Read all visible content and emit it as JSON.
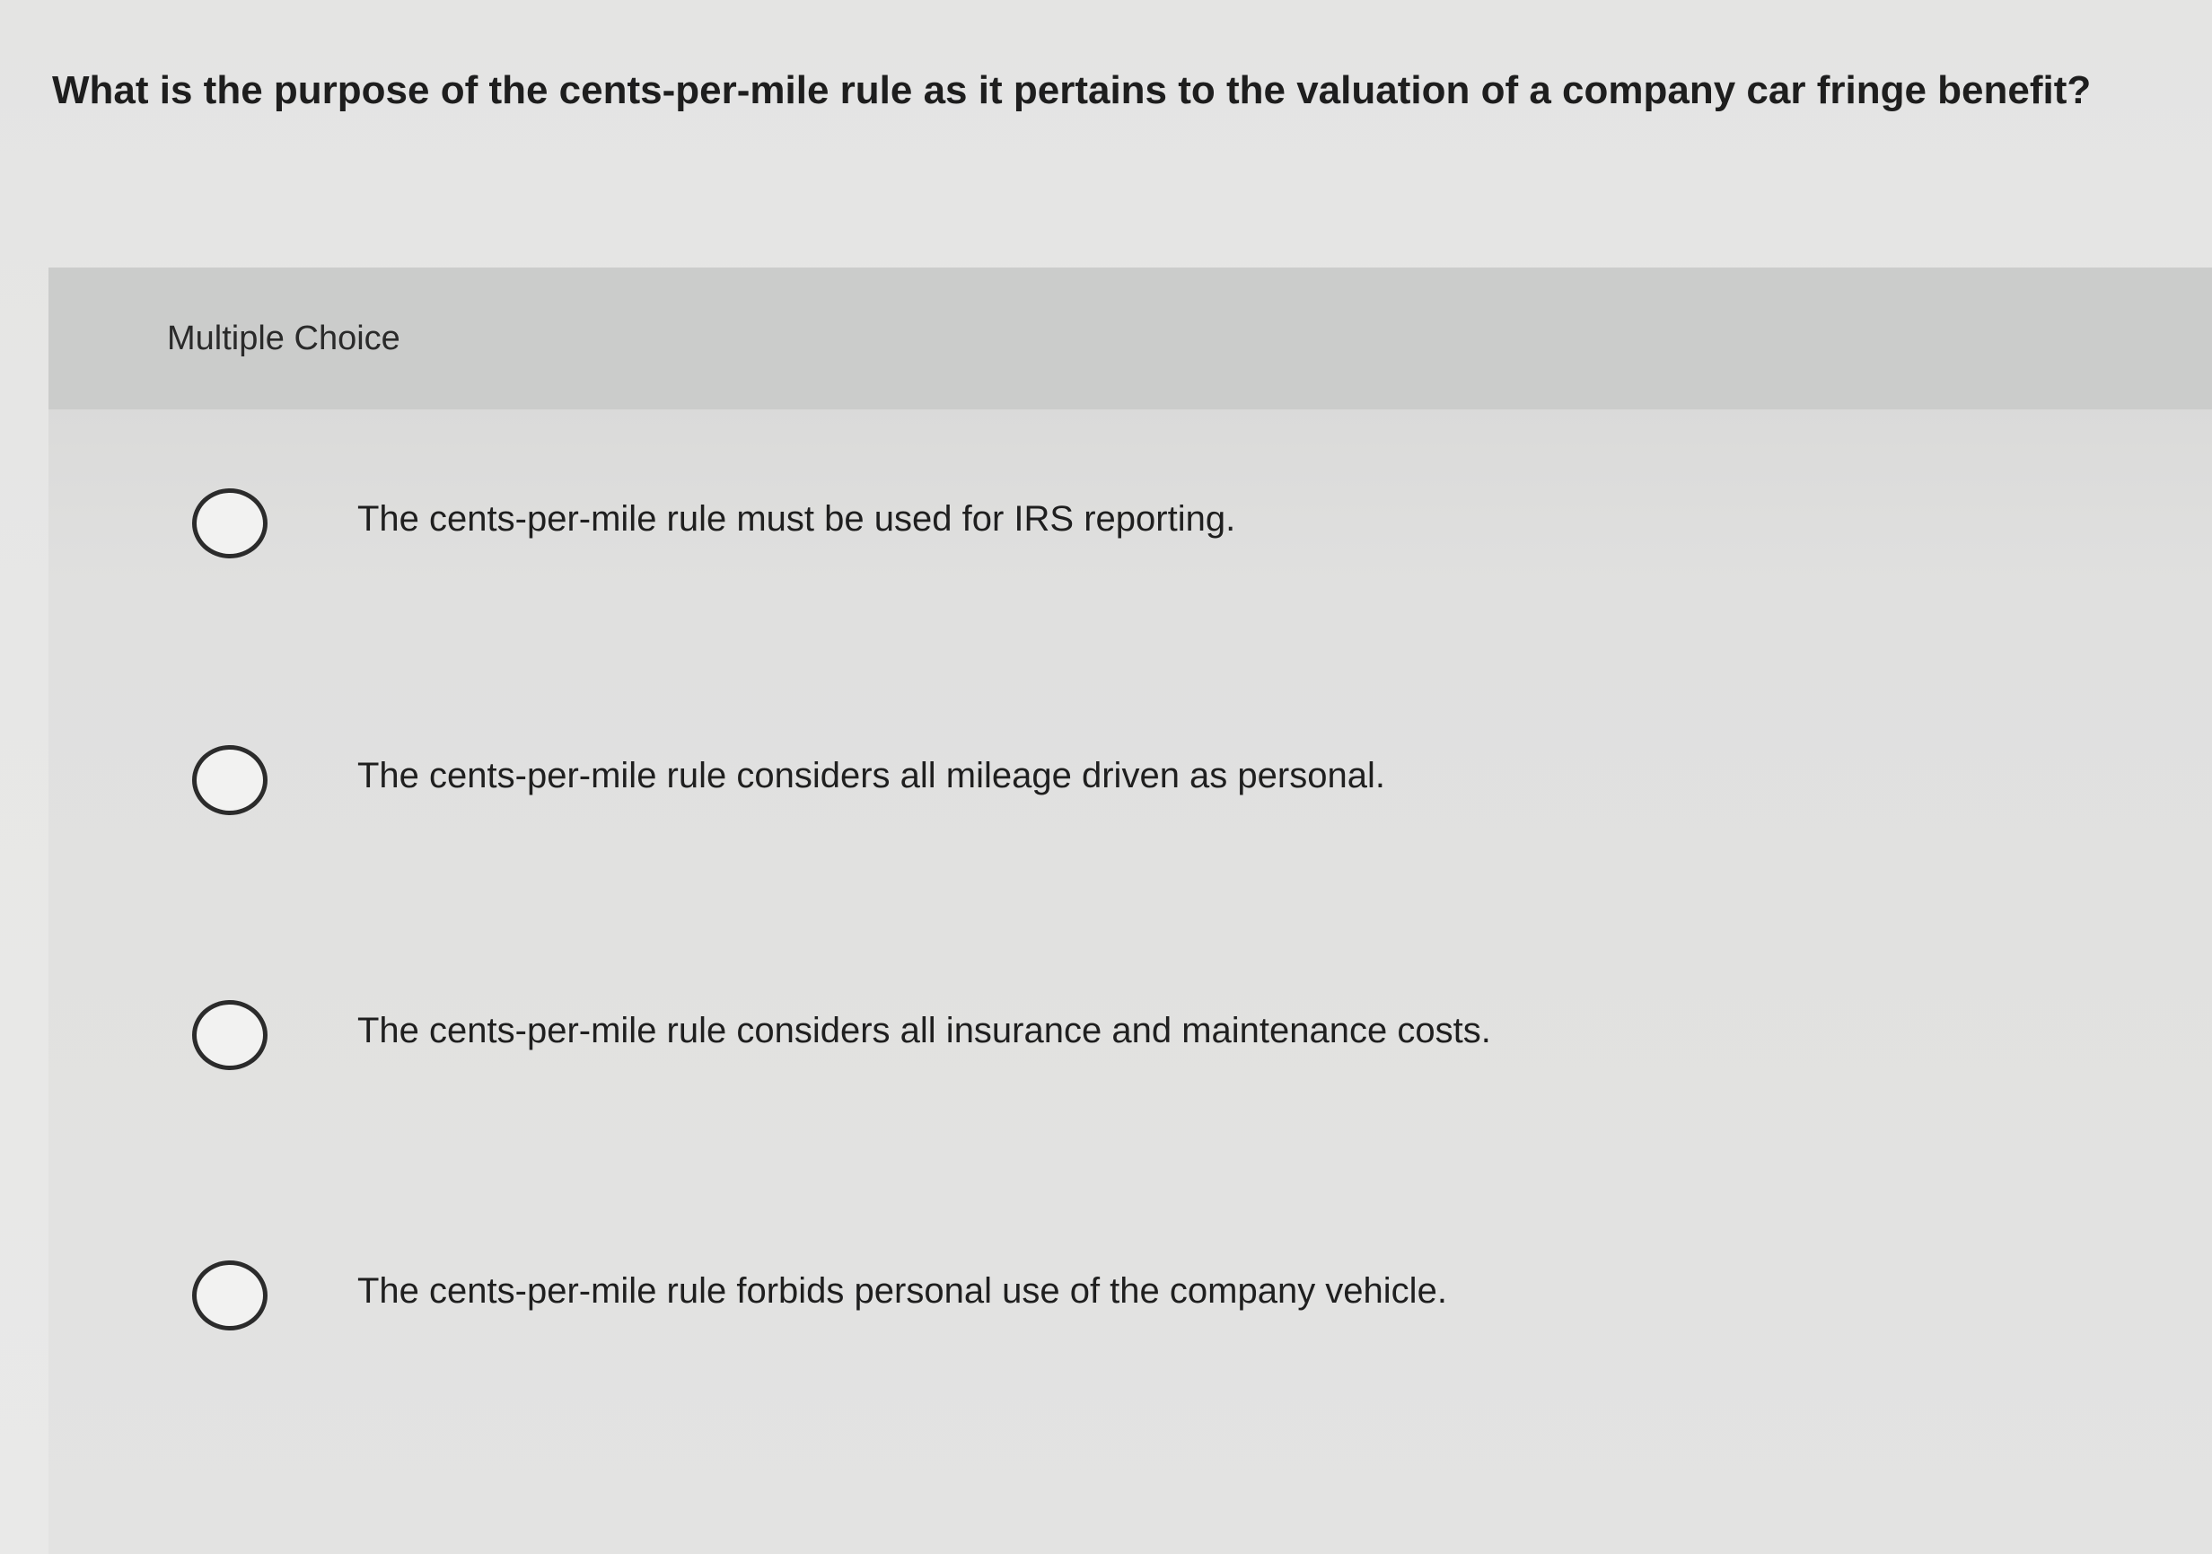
{
  "question": {
    "text": "What is the purpose of the cents-per-mile rule as it pertains to the valuation of a company car fringe benefit?"
  },
  "panel": {
    "label": "Multiple Choice",
    "options": [
      {
        "text": "The cents-per-mile rule must be used for IRS reporting.",
        "selected": false
      },
      {
        "text": "The cents-per-mile rule considers all mileage driven as personal.",
        "selected": false
      },
      {
        "text": "The cents-per-mile rule considers all insurance and maintenance costs.",
        "selected": false
      },
      {
        "text": "The cents-per-mile rule forbids personal use of the company vehicle.",
        "selected": false
      }
    ]
  }
}
